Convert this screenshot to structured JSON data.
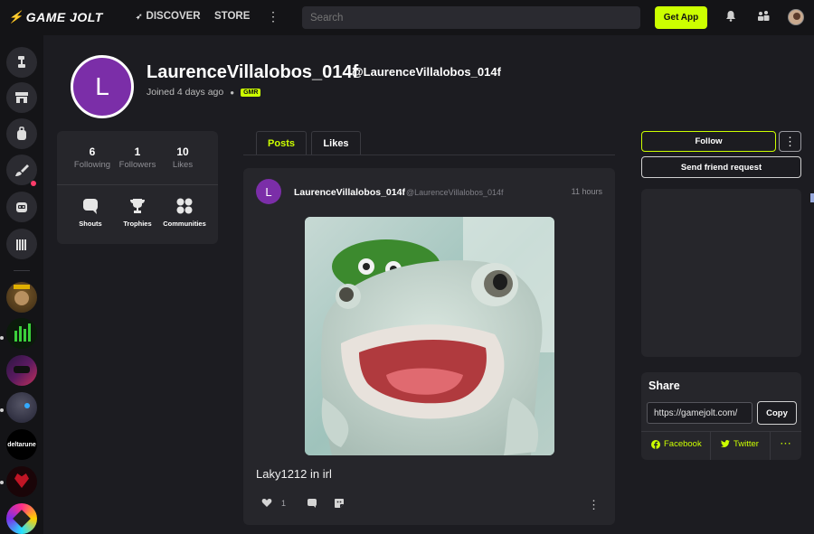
{
  "topbar": {
    "logo_text": "GAME JOLT",
    "discover_label": "DISCOVER",
    "store_label": "STORE",
    "search_placeholder": "Search",
    "get_app_label": "Get App"
  },
  "profile": {
    "avatar_letter": "L",
    "display_name": "LaurenceVillalobos_014f",
    "handle": "@LaurenceVillalobos_014f",
    "joined": "Joined 4 days ago",
    "badge": "GMR",
    "avatar_color": "#7b2ea8"
  },
  "stats": [
    {
      "value": "6",
      "label": "Following"
    },
    {
      "value": "1",
      "label": "Followers"
    },
    {
      "value": "10",
      "label": "Likes"
    }
  ],
  "profile_links": [
    {
      "label": "Shouts",
      "icon": "chat-bubble-icon"
    },
    {
      "label": "Trophies",
      "icon": "trophy-icon"
    },
    {
      "label": "Communities",
      "icon": "communities-icon"
    }
  ],
  "tabs": [
    {
      "label": "Posts",
      "active": true
    },
    {
      "label": "Likes",
      "active": false
    }
  ],
  "post": {
    "avatar_letter": "L",
    "author": "LaurenceVillalobos_014f",
    "handle": "@LaurenceVillalobos_014f",
    "time": "11 hours",
    "text": "Laky1212 in irl",
    "like_count": "1"
  },
  "actions": {
    "follow_label": "Follow",
    "friend_label": "Send friend request"
  },
  "share": {
    "title": "Share",
    "url": "https://gamejolt.com/",
    "copy_label": "Copy",
    "facebook_label": "Facebook",
    "twitter_label": "Twitter"
  },
  "colors": {
    "accent": "#ccff00",
    "background": "#1c1c21",
    "card": "#26262b"
  }
}
